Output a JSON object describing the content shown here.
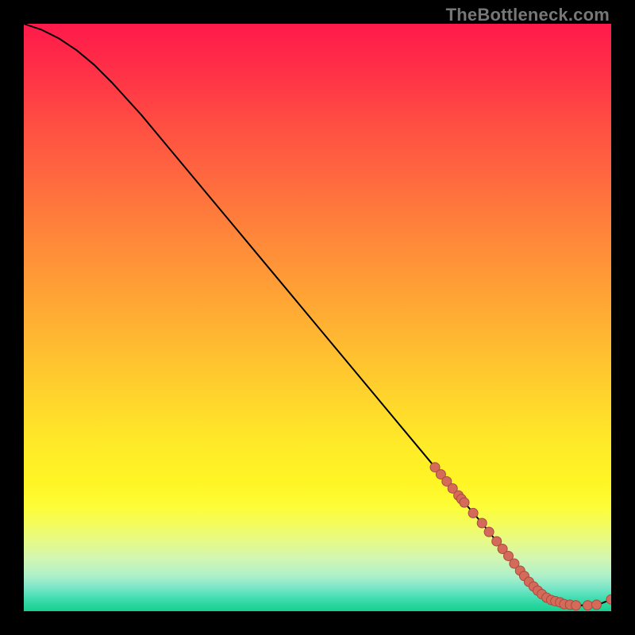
{
  "watermark": "TheBottleneck.com",
  "colors": {
    "curve": "#000000",
    "marker_fill": "#d46a5a",
    "marker_stroke": "#a84b3d",
    "background_black": "#000000"
  },
  "chart_data": {
    "type": "line",
    "title": "",
    "xlabel": "",
    "ylabel": "",
    "xlim": [
      0,
      100
    ],
    "ylim": [
      0,
      100
    ],
    "grid": false,
    "legend": false,
    "series": [
      {
        "name": "curve",
        "x": [
          0,
          3,
          6,
          9,
          12,
          15,
          20,
          25,
          30,
          35,
          40,
          45,
          50,
          55,
          60,
          65,
          70,
          75,
          78,
          80,
          82,
          84,
          86,
          88,
          90,
          92,
          94,
          96,
          98,
          100
        ],
        "y": [
          100,
          99,
          97.5,
          95.5,
          93,
          90,
          84.5,
          78.5,
          72.5,
          66.5,
          60.5,
          54.5,
          48.5,
          42.5,
          36.5,
          30.5,
          24.5,
          18.5,
          15,
          12.5,
          10,
          7.5,
          5,
          3,
          1.8,
          1.2,
          1.0,
          1.0,
          1.2,
          2.0
        ]
      }
    ],
    "markers": [
      {
        "x": 70,
        "y": 24.5
      },
      {
        "x": 71,
        "y": 23.3
      },
      {
        "x": 72,
        "y": 22.1
      },
      {
        "x": 73,
        "y": 20.9
      },
      {
        "x": 74,
        "y": 19.7
      },
      {
        "x": 74.5,
        "y": 19.1
      },
      {
        "x": 75,
        "y": 18.5
      },
      {
        "x": 76.5,
        "y": 16.7
      },
      {
        "x": 78,
        "y": 15.0
      },
      {
        "x": 79.2,
        "y": 13.5
      },
      {
        "x": 80.5,
        "y": 11.9
      },
      {
        "x": 81.5,
        "y": 10.6
      },
      {
        "x": 82.5,
        "y": 9.4
      },
      {
        "x": 83.5,
        "y": 8.1
      },
      {
        "x": 84.5,
        "y": 6.9
      },
      {
        "x": 85.2,
        "y": 6.0
      },
      {
        "x": 86,
        "y": 5.0
      },
      {
        "x": 86.8,
        "y": 4.2
      },
      {
        "x": 87.5,
        "y": 3.5
      },
      {
        "x": 88.2,
        "y": 2.9
      },
      {
        "x": 89,
        "y": 2.3
      },
      {
        "x": 89.8,
        "y": 1.9
      },
      {
        "x": 90.5,
        "y": 1.7
      },
      {
        "x": 91.3,
        "y": 1.5
      },
      {
        "x": 92,
        "y": 1.2
      },
      {
        "x": 93,
        "y": 1.1
      },
      {
        "x": 94,
        "y": 1.0
      },
      {
        "x": 96,
        "y": 1.0
      },
      {
        "x": 97.5,
        "y": 1.1
      },
      {
        "x": 100,
        "y": 2.0
      }
    ]
  }
}
